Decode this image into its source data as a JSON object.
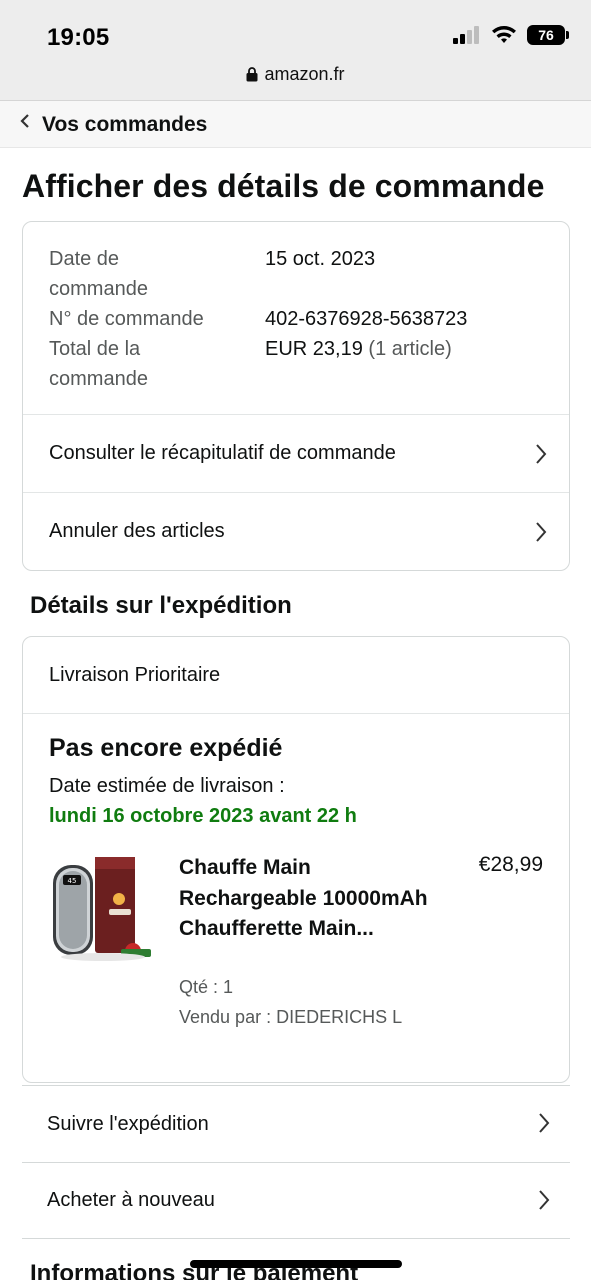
{
  "status_bar": {
    "time": "19:05",
    "battery": "76"
  },
  "browser": {
    "url": "amazon.fr"
  },
  "nav": {
    "back_label": "Vos commandes"
  },
  "page": {
    "title": "Afficher des détails de commande"
  },
  "order_summary": {
    "date_label_1": "Date de",
    "date_label_2": "commande",
    "date_value": "15 oct. 2023",
    "number_label": "N° de commande",
    "number_value": "402-6376928-5638723",
    "total_label_1": "Total de la",
    "total_label_2": "commande",
    "total_value": "EUR 23,19",
    "total_count": "(1 article)"
  },
  "order_actions": {
    "summary_link": "Consulter le récapitulatif de commande",
    "cancel_link": "Annuler des articles"
  },
  "shipping": {
    "section_title": "Détails sur l'expédition",
    "method": "Livraison Prioritaire",
    "status": "Pas encore expédié",
    "estimate_label": "Date estimée de livraison :",
    "estimate_value": "lundi 16 octobre 2023 avant 22 h",
    "item": {
      "title": "Chauffe Main Rechargeable 10000mAh Chaufferette Main...",
      "price": "€28,99",
      "qty": "Qté : 1",
      "seller": "Vendu par : DIEDERICHS L"
    }
  },
  "shipment_actions": {
    "track_link": "Suivre l'expédition",
    "buy_again_link": "Acheter à nouveau"
  },
  "next_section": {
    "title": "Informations sur le paiement"
  },
  "colors": {
    "delivery_green": "#107c10",
    "muted_text": "#565959",
    "border": "#d5d9d9"
  }
}
